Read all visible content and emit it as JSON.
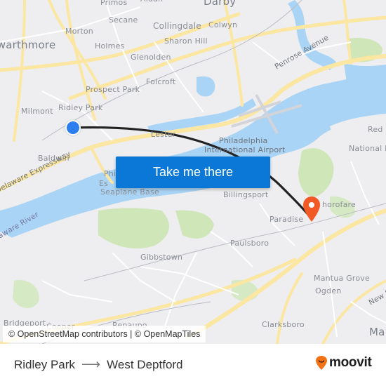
{
  "map": {
    "place_labels": [
      {
        "id": "primos",
        "text": "Primos"
      },
      {
        "id": "aldan",
        "text": "Aldan"
      },
      {
        "id": "darby",
        "text": "Darby"
      },
      {
        "id": "secane",
        "text": "Secane"
      },
      {
        "id": "collingdale",
        "text": "Collingdale"
      },
      {
        "id": "colwyn",
        "text": "Colwyn"
      },
      {
        "id": "morton",
        "text": "Morton"
      },
      {
        "id": "sharon-hill",
        "text": "Sharon Hill"
      },
      {
        "id": "swarthmore",
        "text": "Swarthmore"
      },
      {
        "id": "holmes",
        "text": "Holmes"
      },
      {
        "id": "glenolden",
        "text": "Glenolden"
      },
      {
        "id": "folcroft",
        "text": "Folcroft"
      },
      {
        "id": "prospect-park",
        "text": "Prospect Park"
      },
      {
        "id": "milmont",
        "text": "Milmont"
      },
      {
        "id": "ridley-park",
        "text": "Ridley Park"
      },
      {
        "id": "essington",
        "text": "Lester"
      },
      {
        "id": "baldwin",
        "text": "Baldwin"
      },
      {
        "id": "phl-airport-1",
        "text": "Philadelphia"
      },
      {
        "id": "phl-airport-2",
        "text": "International Airport"
      },
      {
        "id": "seaplane-1",
        "text": "Phi"
      },
      {
        "id": "seaplane-2",
        "text": "Es"
      },
      {
        "id": "seaplane-3",
        "text": "Seaplane Base"
      },
      {
        "id": "red-bank",
        "text": "Red"
      },
      {
        "id": "national-park",
        "text": "National Pa"
      },
      {
        "id": "billingsport",
        "text": "Billingsport"
      },
      {
        "id": "thorofare",
        "text": "horofare"
      },
      {
        "id": "paradise",
        "text": "Paradise"
      },
      {
        "id": "paulsboro",
        "text": "Paulsboro"
      },
      {
        "id": "gibbstown",
        "text": "Gibbstown"
      },
      {
        "id": "mantua-grove",
        "text": "Mantua Grove"
      },
      {
        "id": "ogden",
        "text": "Ogden"
      },
      {
        "id": "bridgeport",
        "text": "Bridgeport"
      },
      {
        "id": "cooper",
        "text": "Cooper"
      },
      {
        "id": "repaupo",
        "text": "Repaupo"
      },
      {
        "id": "clarksboro",
        "text": "Clarksboro"
      },
      {
        "id": "mantua",
        "text": "Ma"
      }
    ],
    "road_labels": [
      {
        "id": "penrose-avenue",
        "text": "Penrose Avenue"
      },
      {
        "id": "delaware-expressway",
        "text": "Delaware Expressway"
      },
      {
        "id": "delaware-river",
        "text": "Delaware River"
      },
      {
        "id": "new-jersey-turnpike",
        "text": "New Je"
      }
    ],
    "cta_label": "Take me there",
    "attribution": "© OpenStreetMap contributors | © OpenMapTiles",
    "colors": {
      "water": "#a9d4f5",
      "land": "#eeeef0",
      "park": "#cfe6b8",
      "major_road": "#fbe6a2",
      "route_line": "#222222",
      "origin": "#2d7ff0",
      "destination": "#f15a24",
      "cta": "#0b78d8"
    }
  },
  "route": {
    "origin": "Ridley Park",
    "destination": "West Deptford",
    "arrow": "⟶"
  },
  "brand": {
    "name": "moovit",
    "color": "#f47216"
  }
}
